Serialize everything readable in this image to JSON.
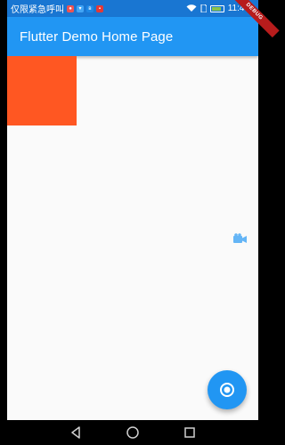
{
  "status_bar": {
    "carrier_text": "仅限紧急呼叫",
    "time": "11:47",
    "icons": [
      "notification-icon",
      "message-icon",
      "bluetooth-icon",
      "app-icon",
      "wifi-icon",
      "sim-icon",
      "battery-icon"
    ]
  },
  "app_bar": {
    "title": "Flutter Demo Home Page"
  },
  "debug_banner": {
    "label": "DEBUG"
  },
  "content": {
    "box_color": "#ff5722",
    "accent_color": "#2196f3"
  },
  "fab": {
    "icon": "radio-button-icon"
  },
  "nav_bar": {
    "buttons": [
      "back-icon",
      "home-icon",
      "recents-icon"
    ]
  }
}
